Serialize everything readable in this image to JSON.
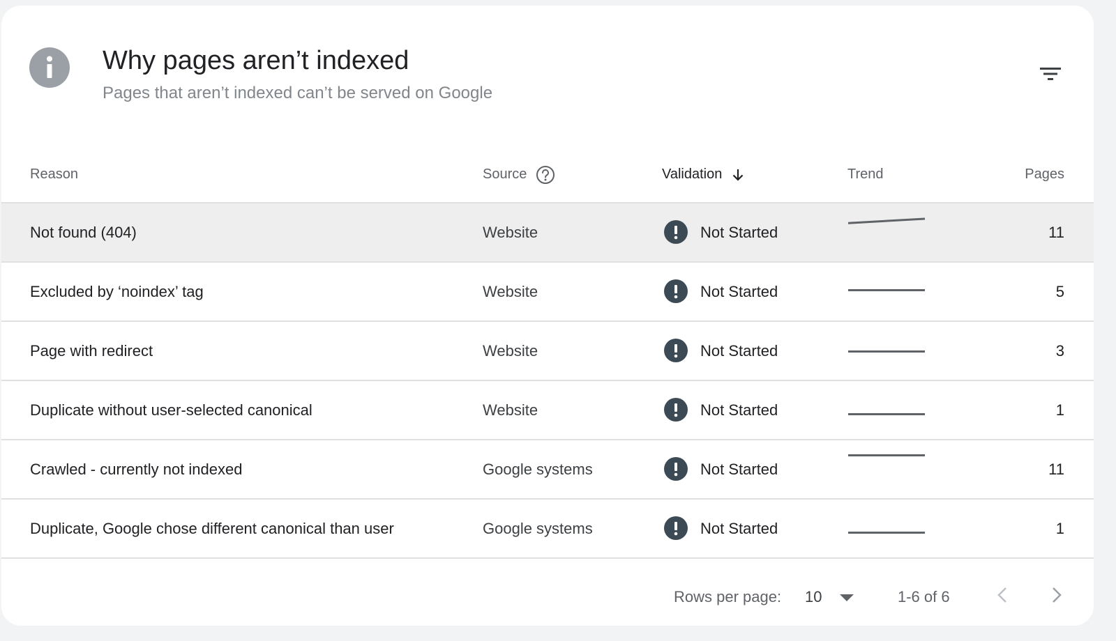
{
  "header": {
    "title": "Why pages aren’t indexed",
    "subtitle": "Pages that aren’t indexed can’t be served on Google",
    "icons": {
      "info": "info-icon",
      "filter": "filter-icon"
    }
  },
  "table": {
    "columns": {
      "reason": "Reason",
      "source": "Source",
      "validation": "Validation",
      "trend": "Trend",
      "pages": "Pages"
    },
    "sort": {
      "column": "validation",
      "direction": "descending"
    },
    "rows": [
      {
        "reason": "Not found (404)",
        "source": "Website",
        "validation": "Not Started",
        "pages": "11",
        "trend": [
          0.35,
          0.55
        ]
      },
      {
        "reason": "Excluded by ‘noindex’ tag",
        "source": "Website",
        "validation": "Not Started",
        "pages": "5",
        "trend": [
          0.5,
          0.5
        ]
      },
      {
        "reason": "Page with redirect",
        "source": "Website",
        "validation": "Not Started",
        "pages": "3",
        "trend": [
          0.5,
          0.5
        ]
      },
      {
        "reason": "Duplicate without user-selected canonical",
        "source": "Website",
        "validation": "Not Started",
        "pages": "1",
        "trend": [
          0.5,
          0.5
        ]
      },
      {
        "reason": "Crawled - currently not indexed",
        "source": "Google systems",
        "validation": "Not Started",
        "pages": "11",
        "trend": [
          0.5,
          0.5
        ]
      },
      {
        "reason": "Duplicate, Google chose different canonical than user",
        "source": "Google systems",
        "validation": "Not Started",
        "pages": "1",
        "trend": [
          0.5,
          0.5
        ]
      }
    ]
  },
  "colors": {
    "status_icon": "#3c4a55",
    "trend_line": "#5f6368",
    "highlight_row": "#eeeeee",
    "info_icon": "#9aa0a6"
  },
  "pagination": {
    "rows_per_page_label": "Rows per page:",
    "rows_per_page_value": "10",
    "range": "1-6 of 6"
  }
}
